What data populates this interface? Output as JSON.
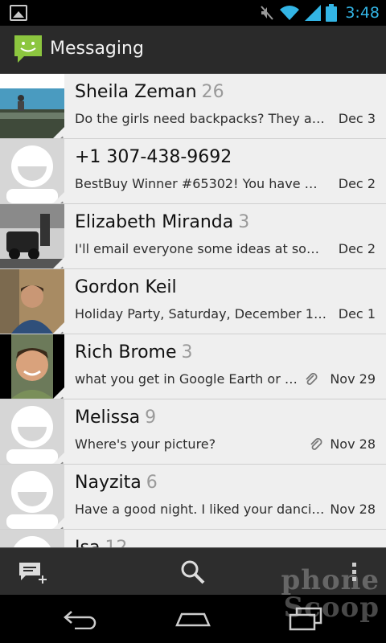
{
  "status_bar": {
    "time": "3:48",
    "icons": [
      "gallery-icon",
      "mute-icon",
      "wifi-icon",
      "signal-icon",
      "battery-icon"
    ]
  },
  "action_bar": {
    "title": "Messaging",
    "app_icon": "messaging-icon"
  },
  "conversations": [
    {
      "name": "Sheila Zeman",
      "count": "26",
      "snippet": "Do the girls need backpacks? They are...",
      "date": "Dec 3",
      "attachment": false,
      "avatar": "photo-beach"
    },
    {
      "name": "+1 307-438-9692",
      "count": "",
      "snippet": "BestBuy Winner #65302! You have WO...",
      "date": "Dec 2",
      "attachment": false,
      "avatar": "default"
    },
    {
      "name": "Elizabeth Miranda",
      "count": "3",
      "snippet": "I'll email everyone some ideas at some...",
      "date": "Dec 2",
      "attachment": false,
      "avatar": "photo-bw"
    },
    {
      "name": "Gordon Keil",
      "count": "",
      "snippet": "Holiday Party, Saturday, December 15, 7...",
      "date": "Dec 1",
      "attachment": false,
      "avatar": "photo-man"
    },
    {
      "name": "Rich Brome",
      "count": "3",
      "snippet": " what you get in Google Earth or Ap...",
      "date": "Nov 29",
      "attachment": true,
      "avatar": "photo-smile"
    },
    {
      "name": "Melissa",
      "count": "9",
      "snippet": "Where's your picture?",
      "date": "Nov 28",
      "attachment": true,
      "avatar": "default"
    },
    {
      "name": "Nayzita",
      "count": "6",
      "snippet": "Have a good night. I liked your dancin...",
      "date": "Nov 28",
      "attachment": false,
      "avatar": "default"
    },
    {
      "name": "Isa",
      "count": "12",
      "snippet": "",
      "date": "",
      "attachment": false,
      "avatar": "default"
    }
  ],
  "bottom_bar": {
    "icons": [
      "compose-icon",
      "search-icon",
      "overflow-menu-icon"
    ]
  },
  "nav_bar": {
    "icons": [
      "back-icon",
      "home-icon",
      "recent-apps-icon"
    ]
  },
  "watermark": {
    "line1": "phone",
    "line2": "Scoop"
  },
  "colors": {
    "status_time": "#33b5e5",
    "action_bar": "#2a2a2a",
    "list_bg": "#efefef",
    "app_icon": "#8cc63f"
  }
}
